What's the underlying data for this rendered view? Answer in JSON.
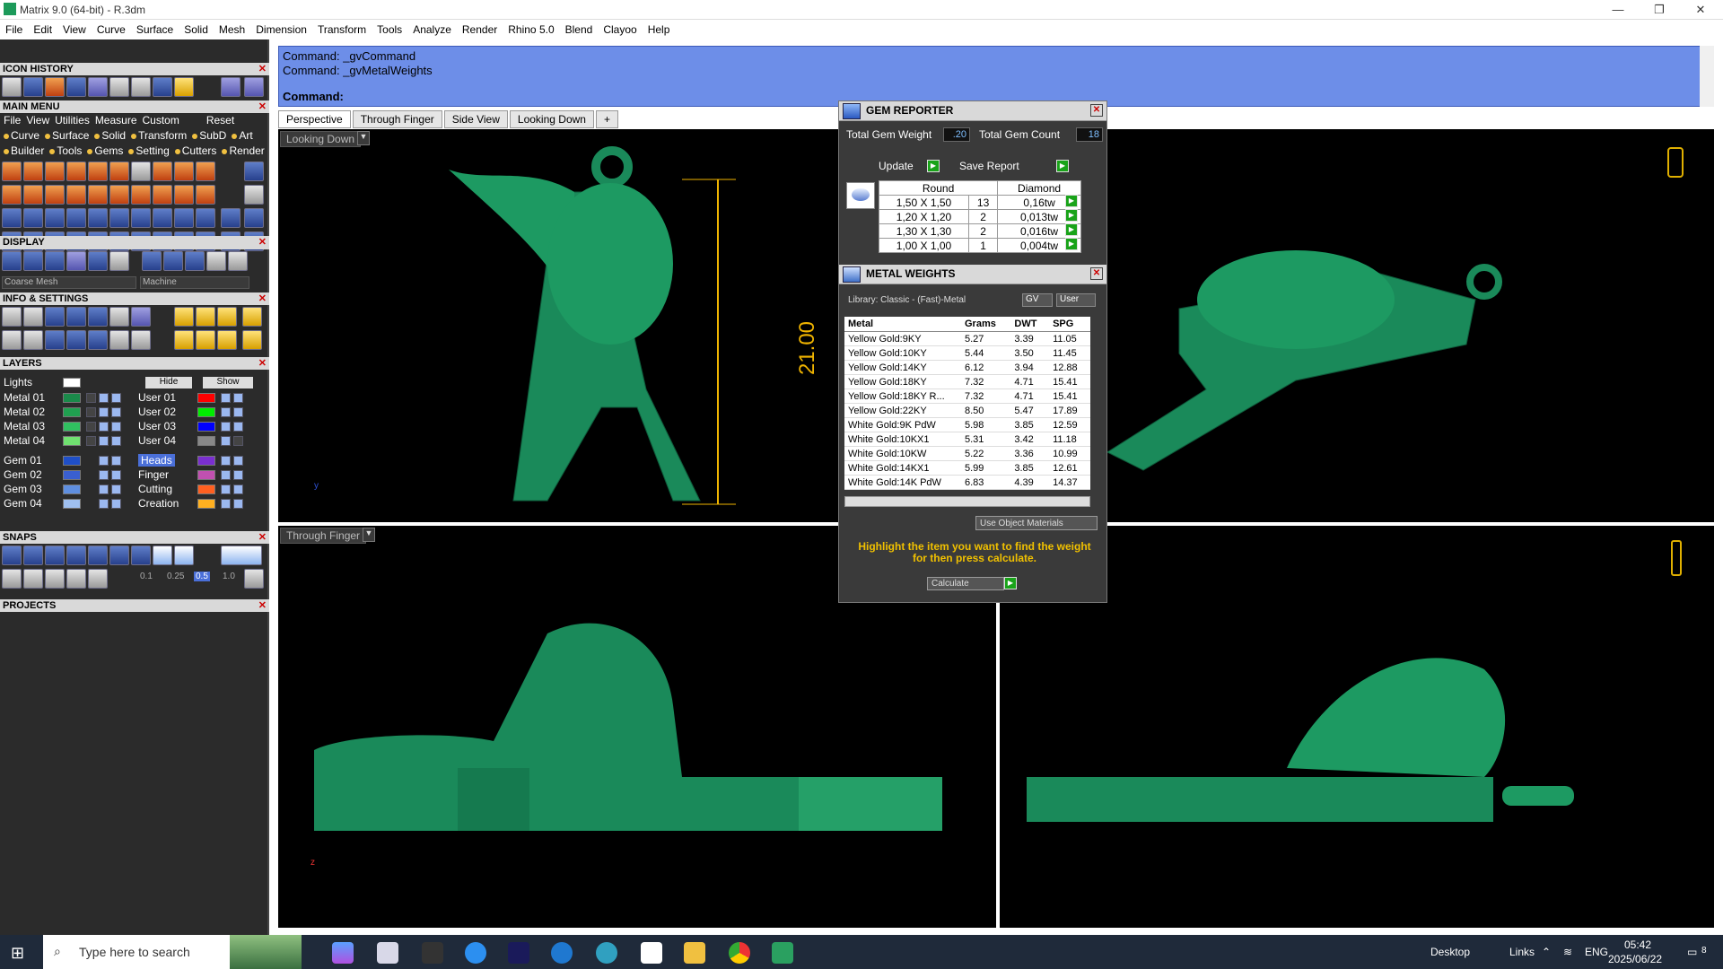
{
  "window": {
    "title": "Matrix 9.0 (64-bit) - R.3dm",
    "min": "—",
    "max": "❐",
    "close": "✕"
  },
  "menubar": [
    "File",
    "Edit",
    "View",
    "Curve",
    "Surface",
    "Solid",
    "Mesh",
    "Dimension",
    "Transform",
    "Tools",
    "Analyze",
    "Render",
    "Rhino 5.0",
    "Blend",
    "Clayoo",
    "Help"
  ],
  "left": {
    "icon_history": "ICON HISTORY",
    "main_menu": "MAIN MENU",
    "main_menu_row1": [
      "File",
      "View",
      "Utilities",
      "Measure",
      "Custom",
      "Reset"
    ],
    "main_menu_row2": [
      "Curve",
      "Surface",
      "Solid",
      "Transform",
      "SubD",
      "Art"
    ],
    "main_menu_row3": [
      "Builder",
      "Tools",
      "Gems",
      "Setting",
      "Cutters",
      "Render"
    ],
    "display": "DISPLAY",
    "display_mesh": "Coarse Mesh",
    "display_mode": "Machine",
    "info": "INFO & SETTINGS",
    "layers": "LAYERS",
    "lights": "Lights",
    "hide": "Hide",
    "show": "Show",
    "layers_left": [
      "Metal 01",
      "Metal 02",
      "Metal 03",
      "Metal 04"
    ],
    "layers_right": [
      "User 01",
      "User 02",
      "User 03",
      "User 04"
    ],
    "layers_left_colors": [
      "#1a8a4a",
      "#20a050",
      "#30c060",
      "#70e070"
    ],
    "layers_right_colors": [
      "#ff0000",
      "#00ee00",
      "#0000ff",
      "#888888"
    ],
    "gem_layers": [
      "Gem 01",
      "Gem 02",
      "Gem 03",
      "Gem 04"
    ],
    "gem_right": [
      "Heads",
      "Finger",
      "Cutting",
      "Creation"
    ],
    "gem_colors": [
      "#1f4fc8",
      "#3a5fd0",
      "#5f8fe0",
      "#9fc0f0"
    ],
    "gem_right_colors": [
      "#7a2fd0",
      "#c050b0",
      "#ff6020",
      "#ffb020"
    ],
    "snaps": "SNAPS",
    "snap_values": [
      "0.1",
      "0.25",
      "0.5",
      "1.0"
    ],
    "projects": "PROJECTS"
  },
  "command": {
    "line1": "Command: _gvCommand",
    "line2": "Command: _gvMetalWeights",
    "prompt": "Command:"
  },
  "tabs": [
    "Perspective",
    "Through Finger",
    "Side View",
    "Looking Down"
  ],
  "viewports": {
    "top_left": "Looking Down",
    "bottom_left": "Through Finger",
    "dimension": "21.00"
  },
  "gem_reporter": {
    "title": "GEM REPORTER",
    "total_weight_label": "Total Gem Weight",
    "total_weight": ".20",
    "total_count_label": "Total Gem Count",
    "total_count": "18",
    "update": "Update",
    "save_report": "Save Report",
    "shape": "Round",
    "material": "Diamond",
    "rows": [
      {
        "size": "1,50 X 1,50",
        "count": "13",
        "tw": "0,16tw"
      },
      {
        "size": "1,20 X 1,20",
        "count": "2",
        "tw": "0,013tw"
      },
      {
        "size": "1,30 X 1,30",
        "count": "2",
        "tw": "0,016tw"
      },
      {
        "size": "1,00 X 1,00",
        "count": "1",
        "tw": "0,004tw"
      }
    ]
  },
  "metal_weights": {
    "title": "METAL WEIGHTS",
    "library": "Library: Classic - (Fast)-Metal",
    "gv": "GV",
    "user": "User",
    "columns": [
      "Metal",
      "Grams",
      "DWT",
      "SPG"
    ],
    "rows": [
      [
        "Yellow Gold:9KY",
        "5.27",
        "3.39",
        "11.05"
      ],
      [
        "Yellow Gold:10KY",
        "5.44",
        "3.50",
        "11.45"
      ],
      [
        "Yellow Gold:14KY",
        "6.12",
        "3.94",
        "12.88"
      ],
      [
        "Yellow Gold:18KY",
        "7.32",
        "4.71",
        "15.41"
      ],
      [
        "Yellow Gold:18KY R...",
        "7.32",
        "4.71",
        "15.41"
      ],
      [
        "Yellow Gold:22KY",
        "8.50",
        "5.47",
        "17.89"
      ],
      [
        "White Gold:9K PdW",
        "5.98",
        "3.85",
        "12.59"
      ],
      [
        "White Gold:10KX1",
        "5.31",
        "3.42",
        "11.18"
      ],
      [
        "White Gold:10KW",
        "5.22",
        "3.36",
        "10.99"
      ],
      [
        "White Gold:14KX1",
        "5.99",
        "3.85",
        "12.61"
      ],
      [
        "White Gold:14K PdW",
        "6.83",
        "4.39",
        "14.37"
      ]
    ],
    "use_object_materials": "Use Object Materials",
    "hint": "Highlight the item you want to find the weight for then press calculate.",
    "calculate": "Calculate"
  },
  "taskbar": {
    "search": "Type here to search",
    "desktop": "Desktop",
    "links": "Links",
    "lang": "ENG",
    "time": "05:42",
    "date": "2025/06/22",
    "notif": "8"
  },
  "colors": {
    "model": "#1a8a5a",
    "gem": "#8a2fc0",
    "accent": "#6d8ee8"
  }
}
